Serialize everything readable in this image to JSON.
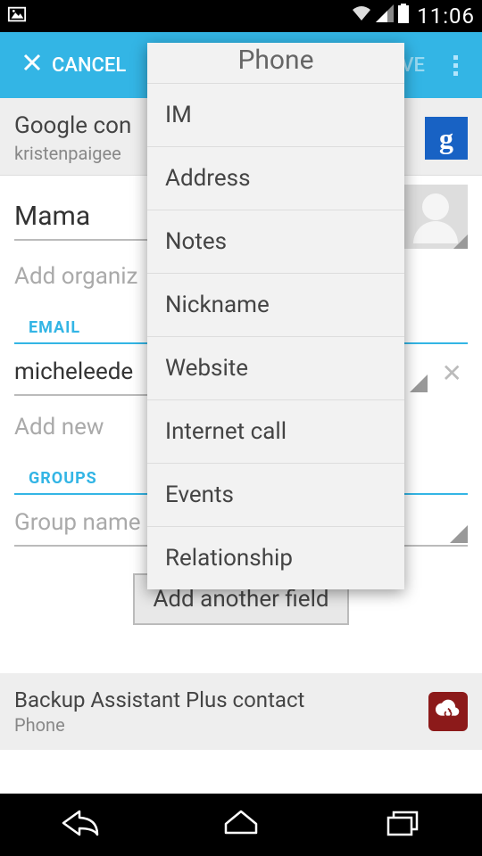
{
  "status": {
    "time": "11:06"
  },
  "actionbar": {
    "cancel": "CANCEL",
    "save": "SAVE"
  },
  "account": {
    "title_visible": "Google con",
    "sub_visible": "kristenpaigee"
  },
  "name_value": "Mama",
  "organization_placeholder": "Add organiz",
  "sections": {
    "email_label": "EMAIL",
    "groups_label": "GROUPS"
  },
  "email": {
    "value_visible": "micheleede",
    "add_placeholder": "Add new"
  },
  "groups": {
    "placeholder": "Group name"
  },
  "add_button": "Add another field",
  "backup": {
    "title": "Backup Assistant Plus contact",
    "sub": "Phone"
  },
  "popup": {
    "partial_top": "Phone",
    "items": [
      "IM",
      "Address",
      "Notes",
      "Nickname",
      "Website",
      "Internet call",
      "Events",
      "Relationship"
    ]
  }
}
